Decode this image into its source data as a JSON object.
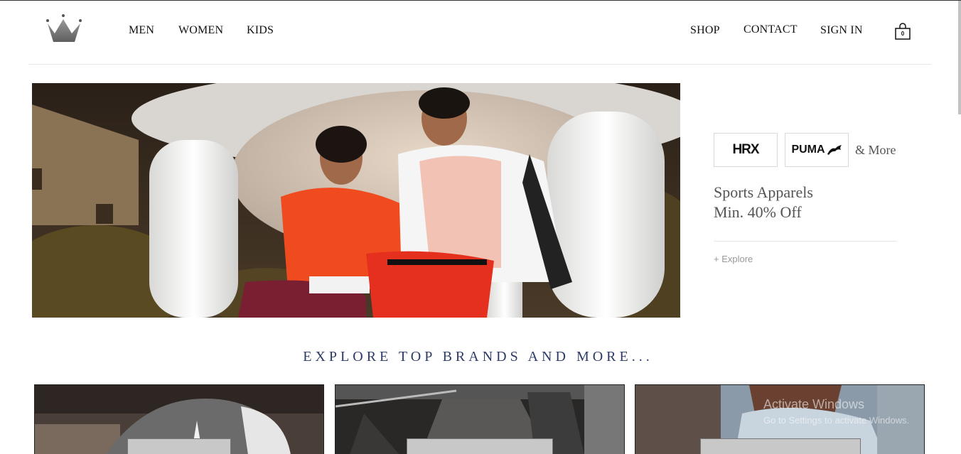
{
  "header": {
    "nav_left": [
      "MEN",
      "WOMEN",
      "KIDS"
    ],
    "nav_right": [
      "SHOP",
      "CONTACT",
      "SIGN IN"
    ],
    "cart_count": "0"
  },
  "promo": {
    "brands": [
      "HRX",
      "PUMA"
    ],
    "more": "& More",
    "title": "Sports Apparels",
    "subtitle": "Min. 40% Off",
    "explore": "+ Explore"
  },
  "section": {
    "heading": "EXPLORE TOP BRANDS AND MORE..."
  },
  "watermark": {
    "title": "Activate Windows",
    "subtitle": "Go to Settings to activate Windows."
  },
  "colors": {
    "heading": "#2d3b66",
    "promo_text": "#555555",
    "logo": "#6e6e6e"
  },
  "icons": [
    "crown-logo-icon",
    "shopping-bag-icon",
    "puma-cat-icon"
  ]
}
